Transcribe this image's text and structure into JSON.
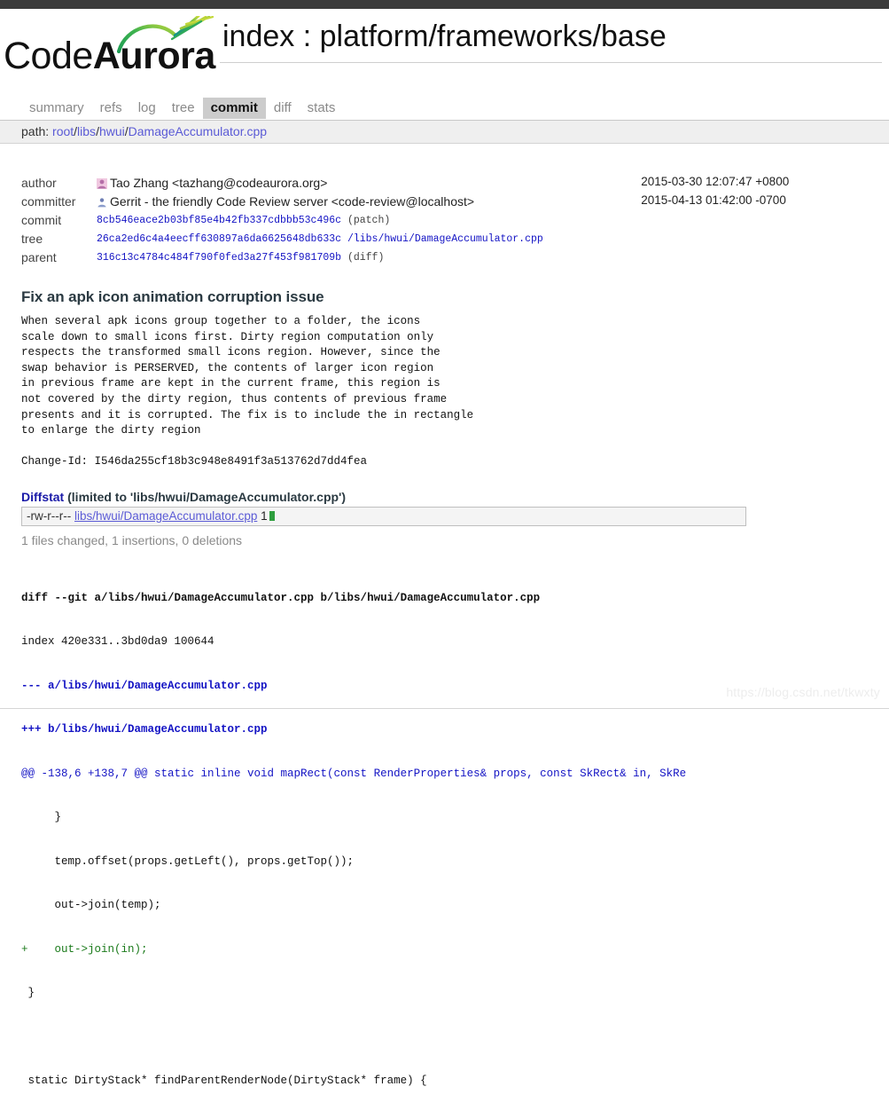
{
  "site": {
    "logo_light": "Code",
    "logo_bold": "Aurora",
    "top_band_color": "#3b3b3b"
  },
  "header": {
    "title": "index : platform/frameworks/base"
  },
  "tabs": [
    {
      "label": "summary",
      "active": false
    },
    {
      "label": "refs",
      "active": false
    },
    {
      "label": "log",
      "active": false
    },
    {
      "label": "tree",
      "active": false
    },
    {
      "label": "commit",
      "active": true
    },
    {
      "label": "diff",
      "active": false
    },
    {
      "label": "stats",
      "active": false
    }
  ],
  "pathbar": {
    "label": "path:",
    "segments": [
      "root",
      "libs",
      "hwui",
      "DamageAccumulator.cpp"
    ],
    "separator": "/"
  },
  "commit_info": {
    "rows": [
      {
        "label": "author",
        "icon": "author-avatar-icon",
        "value": "Tao Zhang <tazhang@codeaurora.org>",
        "date": "2015-03-30 12:07:47 +0800",
        "mono": false
      },
      {
        "label": "committer",
        "icon": "committer-avatar-icon",
        "value": "Gerrit - the friendly Code Review server <code-review@localhost>",
        "date": "2015-04-13 01:42:00 -0700",
        "mono": false
      },
      {
        "label": "commit",
        "value": "8cb546eace2b03bf85e4b42fb337cdbbb53c496c",
        "suffix": "(patch)",
        "date": "",
        "mono": true
      },
      {
        "label": "tree",
        "value": "26ca2ed6c4a4eecff630897a6da6625648db633c",
        "suffix": "/libs/hwui/DamageAccumulator.cpp",
        "date": "",
        "mono": true
      },
      {
        "label": "parent",
        "value": "316c13c4784c484f790f0fed3a27f453f981709b",
        "suffix": "(diff)",
        "date": "",
        "mono": true
      }
    ]
  },
  "commit": {
    "subject": "Fix an apk icon animation corruption issue",
    "body": "When several apk icons group together to a folder, the icons\nscale down to small icons first. Dirty region computation only\nrespects the transformed small icons region. However, since the\nswap behavior is PERSERVED, the contents of larger icon region\nin previous frame are kept in the current frame, this region is\nnot covered by the dirty region, thus contents of previous frame\npresents and it is corrupted. The fix is to include the in rectangle\nto enlarge the dirty region\n\nChange-Id: I546da255cf18b3c948e8491f3a513762d7dd4fea"
  },
  "diffstat": {
    "title": "Diffstat",
    "scope": "(limited to 'libs/hwui/DamageAccumulator.cpp')",
    "rows": [
      {
        "mode": "-rw-r--r--",
        "file": "libs/hwui/DamageAccumulator.cpp",
        "count": "1",
        "added_blocks": 1,
        "removed_blocks": 0
      }
    ],
    "summary": "1 files changed, 1 insertions, 0 deletions"
  },
  "diff": {
    "lines": [
      {
        "kind": "head",
        "text": "diff --git a/libs/hwui/DamageAccumulator.cpp b/libs/hwui/DamageAccumulator.cpp"
      },
      {
        "kind": "idx",
        "text": "index 420e331..3bd0da9 100644"
      },
      {
        "kind": "minus",
        "text": "--- a/libs/hwui/DamageAccumulator.cpp"
      },
      {
        "kind": "plus",
        "text": "+++ b/libs/hwui/DamageAccumulator.cpp"
      },
      {
        "kind": "hunk",
        "text": "@@ -138,6 +138,7 @@ static inline void mapRect(const RenderProperties& props, const SkRect& in, SkRe"
      },
      {
        "kind": "ctx",
        "text": "     }"
      },
      {
        "kind": "ctx",
        "text": "     temp.offset(props.getLeft(), props.getTop());"
      },
      {
        "kind": "ctx",
        "text": "     out->join(temp);"
      },
      {
        "kind": "add",
        "text": "+    out->join(in);"
      },
      {
        "kind": "ctx",
        "text": " }"
      },
      {
        "kind": "ctx",
        "text": ""
      },
      {
        "kind": "ctx",
        "text": " static DirtyStack* findParentRenderNode(DirtyStack* frame) {"
      }
    ]
  },
  "watermark": {
    "text": "https://blog.csdn.net/tkwxty"
  },
  "colors": {
    "link": "#5b5bd6",
    "mono_link": "#1313c4",
    "added": "#1a7a1a",
    "graph_add": "#2e9e3e",
    "tab_active_bg": "#cccccc",
    "pathbar_bg": "#efefef"
  }
}
